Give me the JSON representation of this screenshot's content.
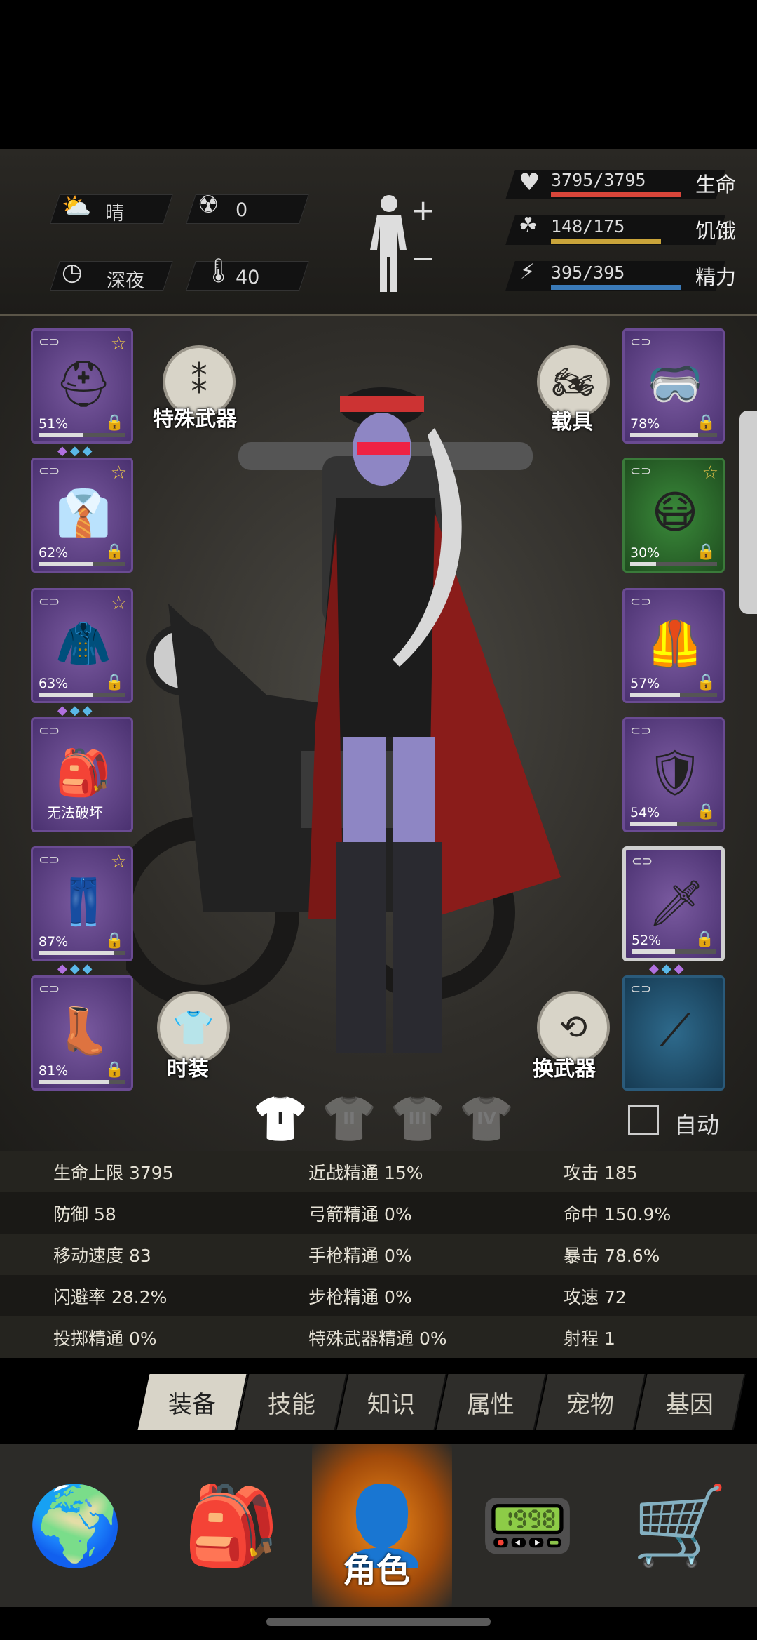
{
  "hud": {
    "weather": "晴",
    "radiation": "0",
    "time": "深夜",
    "temperature": "40",
    "life": {
      "value": "3795/3795",
      "label": "生命",
      "fill": 1.0,
      "color": "#d9463a"
    },
    "hunger": {
      "value": "148/175",
      "label": "饥饿",
      "fill": 0.846,
      "color": "#c9a43a"
    },
    "energy": {
      "value": "395/395",
      "label": "精力",
      "fill": 1.0,
      "color": "#3a7ab8"
    },
    "icons": {
      "weather": "sun-cloud-icon",
      "radiation": "radiation-icon",
      "time": "clock-icon",
      "temperature": "thermometer-icon",
      "body": "body-plus-minus-icon"
    }
  },
  "left_slots": [
    {
      "pct": "51%",
      "fill": 0.51,
      "icon": "police-helmet-icon"
    },
    {
      "pct": "62%",
      "fill": 0.62,
      "icon": "shirt-icon"
    },
    {
      "pct": "63%",
      "fill": 0.63,
      "icon": "jacket-icon"
    },
    {
      "pct": "",
      "label": "无法破坏",
      "icon": "backpack-icon"
    },
    {
      "pct": "87%",
      "fill": 0.87,
      "icon": "pants-icon"
    },
    {
      "pct": "81%",
      "fill": 0.81,
      "icon": "boots-icon"
    }
  ],
  "right_slots": [
    {
      "pct": "78%",
      "fill": 0.78,
      "icon": "goggles-icon"
    },
    {
      "pct": "30%",
      "fill": 0.3,
      "icon": "mask-icon"
    },
    {
      "pct": "57%",
      "fill": 0.57,
      "icon": "vest-icon"
    },
    {
      "pct": "54%",
      "fill": 0.54,
      "icon": "shield-icon"
    },
    {
      "pct": "52%",
      "fill": 0.52,
      "icon": "sword-icon"
    },
    {
      "pct": "",
      "icon": "spear-icon"
    }
  ],
  "buttons": {
    "special_weapon": "特殊武器",
    "vehicle": "载具",
    "fashion": "时装",
    "swap_weapon": "换武器",
    "auto": "自动"
  },
  "outfits": [
    "I",
    "II",
    "III",
    "IV"
  ],
  "stats": [
    [
      "生命上限 3795",
      "近战精通 15%",
      "攻击 185"
    ],
    [
      "防御 58",
      "弓箭精通 0%",
      "命中 150.9%"
    ],
    [
      "移动速度 83",
      "手枪精通 0%",
      "暴击 78.6%"
    ],
    [
      "闪避率 28.2%",
      "步枪精通 0%",
      "攻速 72"
    ],
    [
      "投掷精通 0%",
      "特殊武器精通 0%",
      "射程 1"
    ]
  ],
  "tabs": [
    "装备",
    "技能",
    "知识",
    "属性",
    "宠物",
    "基因"
  ],
  "nav": {
    "active_label": "角色",
    "items": [
      "globe-icon",
      "backpack-icon",
      "character-icon",
      "walkie-talkie-icon",
      "cart-icon"
    ]
  }
}
